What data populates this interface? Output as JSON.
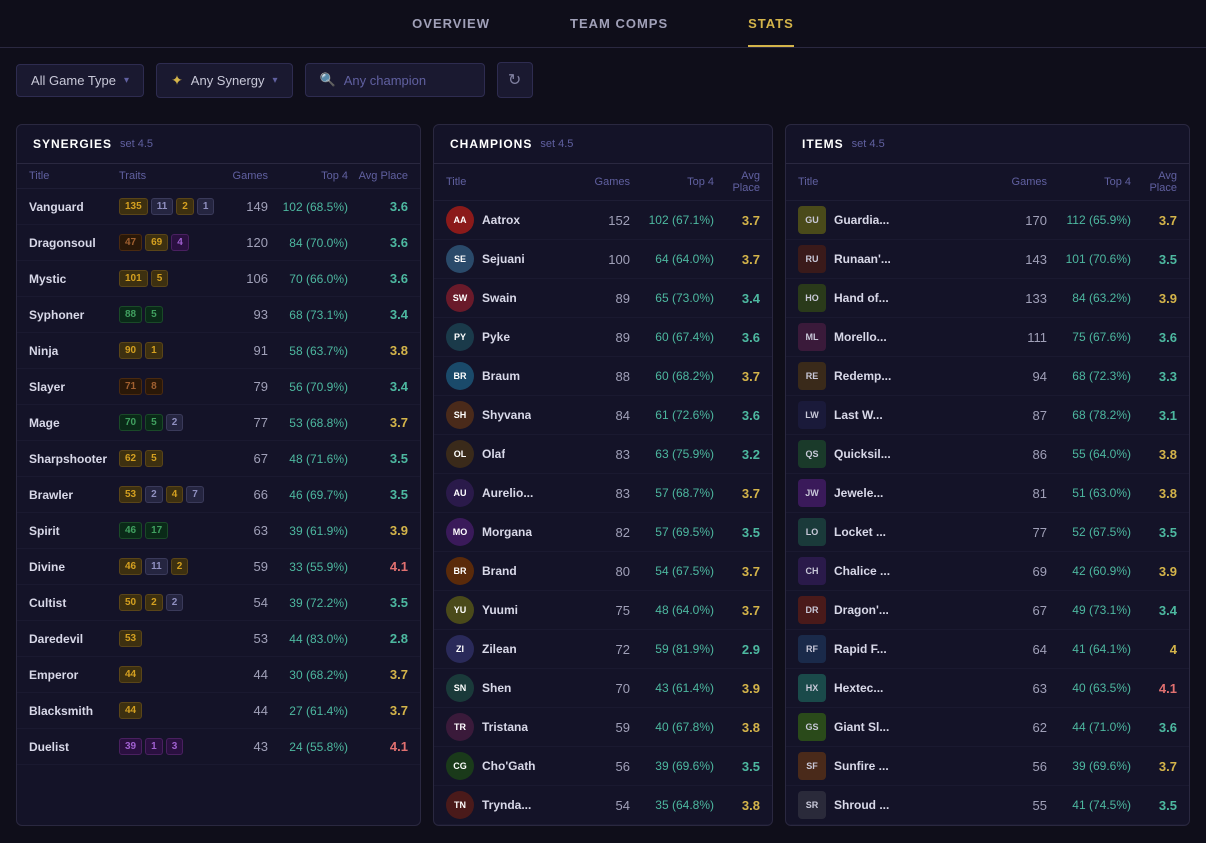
{
  "nav": {
    "items": [
      {
        "id": "overview",
        "label": "OVERVIEW",
        "active": false
      },
      {
        "id": "team-comps",
        "label": "TEAM COMPS",
        "active": false
      },
      {
        "id": "stats",
        "label": "STATS",
        "active": true
      }
    ]
  },
  "filters": {
    "game_type_label": "All Game Type",
    "synergy_label": "Any Synergy",
    "champion_placeholder": "Any champion",
    "refresh_icon": "↻"
  },
  "synergies": {
    "title": "SYNERGIES",
    "set": "set 4.5",
    "columns": [
      "Title",
      "Traits",
      "Games",
      "Top 4",
      "Avg Place"
    ],
    "rows": [
      {
        "name": "Vanguard",
        "badges": [
          {
            "color": "gold",
            "val": "135"
          },
          {
            "color": "silver",
            "val": "11"
          },
          {
            "color": "gold",
            "val": "2"
          },
          {
            "color": "silver",
            "val": "1"
          }
        ],
        "games": 149,
        "top4": "102 (68.5%)",
        "avg": "3.6",
        "avg_class": "avg-good"
      },
      {
        "name": "Dragonsoul",
        "badges": [
          {
            "color": "bronze",
            "val": "47"
          },
          {
            "color": "gold",
            "val": "69"
          },
          {
            "color": "purple",
            "val": "4"
          }
        ],
        "games": 120,
        "top4": "84 (70.0%)",
        "avg": "3.6",
        "avg_class": "avg-good"
      },
      {
        "name": "Mystic",
        "badges": [
          {
            "color": "gold",
            "val": "101"
          },
          {
            "color": "gold",
            "val": "5"
          }
        ],
        "games": 106,
        "top4": "70 (66.0%)",
        "avg": "3.6",
        "avg_class": "avg-good"
      },
      {
        "name": "Syphoner",
        "badges": [
          {
            "color": "green",
            "val": "88"
          },
          {
            "color": "green",
            "val": "5"
          }
        ],
        "games": 93,
        "top4": "68 (73.1%)",
        "avg": "3.4",
        "avg_class": "avg-good"
      },
      {
        "name": "Ninja",
        "badges": [
          {
            "color": "gold",
            "val": "90"
          },
          {
            "color": "gold",
            "val": "1"
          }
        ],
        "games": 91,
        "top4": "58 (63.7%)",
        "avg": "3.8",
        "avg_class": "avg-mid"
      },
      {
        "name": "Slayer",
        "badges": [
          {
            "color": "bronze",
            "val": "71"
          },
          {
            "color": "bronze",
            "val": "8"
          }
        ],
        "games": 79,
        "top4": "56 (70.9%)",
        "avg": "3.4",
        "avg_class": "avg-good"
      },
      {
        "name": "Mage",
        "badges": [
          {
            "color": "green",
            "val": "70"
          },
          {
            "color": "green",
            "val": "5"
          },
          {
            "color": "silver",
            "val": "2"
          }
        ],
        "games": 77,
        "top4": "53 (68.8%)",
        "avg": "3.7",
        "avg_class": "avg-mid"
      },
      {
        "name": "Sharpshooter",
        "badges": [
          {
            "color": "gold",
            "val": "62"
          },
          {
            "color": "gold",
            "val": "5"
          }
        ],
        "games": 67,
        "top4": "48 (71.6%)",
        "avg": "3.5",
        "avg_class": "avg-good"
      },
      {
        "name": "Brawler",
        "badges": [
          {
            "color": "gold",
            "val": "53"
          },
          {
            "color": "silver",
            "val": "2"
          },
          {
            "color": "gold",
            "val": "4"
          },
          {
            "color": "silver",
            "val": "7"
          }
        ],
        "games": 66,
        "top4": "46 (69.7%)",
        "avg": "3.5",
        "avg_class": "avg-good"
      },
      {
        "name": "Spirit",
        "badges": [
          {
            "color": "green",
            "val": "46"
          },
          {
            "color": "green",
            "val": "17"
          }
        ],
        "games": 63,
        "top4": "39 (61.9%)",
        "avg": "3.9",
        "avg_class": "avg-mid"
      },
      {
        "name": "Divine",
        "badges": [
          {
            "color": "gold",
            "val": "46"
          },
          {
            "color": "silver",
            "val": "11"
          },
          {
            "color": "gold",
            "val": "2"
          }
        ],
        "games": 59,
        "top4": "33 (55.9%)",
        "avg": "4.1",
        "avg_class": "avg-bad"
      },
      {
        "name": "Cultist",
        "badges": [
          {
            "color": "gold",
            "val": "50"
          },
          {
            "color": "gold",
            "val": "2"
          },
          {
            "color": "silver",
            "val": "2"
          }
        ],
        "games": 54,
        "top4": "39 (72.2%)",
        "avg": "3.5",
        "avg_class": "avg-good"
      },
      {
        "name": "Daredevil",
        "badges": [
          {
            "color": "gold",
            "val": "53"
          }
        ],
        "games": 53,
        "top4": "44 (83.0%)",
        "avg": "2.8",
        "avg_class": "avg-good"
      },
      {
        "name": "Emperor",
        "badges": [
          {
            "color": "gold",
            "val": "44"
          }
        ],
        "games": 44,
        "top4": "30 (68.2%)",
        "avg": "3.7",
        "avg_class": "avg-mid"
      },
      {
        "name": "Blacksmith",
        "badges": [
          {
            "color": "gold",
            "val": "44"
          }
        ],
        "games": 44,
        "top4": "27 (61.4%)",
        "avg": "3.7",
        "avg_class": "avg-mid"
      },
      {
        "name": "Duelist",
        "badges": [
          {
            "color": "purple",
            "val": "39"
          },
          {
            "color": "purple",
            "val": "1"
          },
          {
            "color": "purple",
            "val": "3"
          }
        ],
        "games": 43,
        "top4": "24 (55.8%)",
        "avg": "4.1",
        "avg_class": "avg-bad"
      }
    ]
  },
  "champions": {
    "title": "CHAMPIONS",
    "set": "set 4.5",
    "columns": [
      "Title",
      "Games",
      "Top 4",
      "Avg Place"
    ],
    "rows": [
      {
        "name": "Aatrox",
        "color": "#8b1a1a",
        "initials": "AA",
        "games": 152,
        "top4": "102 (67.1%)",
        "avg": "3.7",
        "avg_class": "avg-mid"
      },
      {
        "name": "Sejuani",
        "color": "#2a4a6a",
        "initials": "SE",
        "games": 100,
        "top4": "64 (64.0%)",
        "avg": "3.7",
        "avg_class": "avg-mid"
      },
      {
        "name": "Swain",
        "color": "#6a1a2a",
        "initials": "SW",
        "games": 89,
        "top4": "65 (73.0%)",
        "avg": "3.4",
        "avg_class": "avg-good"
      },
      {
        "name": "Pyke",
        "color": "#1a3a4a",
        "initials": "PY",
        "games": 89,
        "top4": "60 (67.4%)",
        "avg": "3.6",
        "avg_class": "avg-good"
      },
      {
        "name": "Braum",
        "color": "#1a4a6a",
        "initials": "BR",
        "games": 88,
        "top4": "60 (68.2%)",
        "avg": "3.7",
        "avg_class": "avg-mid"
      },
      {
        "name": "Shyvana",
        "color": "#4a2a1a",
        "initials": "SH",
        "games": 84,
        "top4": "61 (72.6%)",
        "avg": "3.6",
        "avg_class": "avg-good"
      },
      {
        "name": "Olaf",
        "color": "#3a2a1a",
        "initials": "OL",
        "games": 83,
        "top4": "63 (75.9%)",
        "avg": "3.2",
        "avg_class": "avg-good"
      },
      {
        "name": "Aurelio...",
        "color": "#2a1a4a",
        "initials": "AU",
        "games": 83,
        "top4": "57 (68.7%)",
        "avg": "3.7",
        "avg_class": "avg-mid"
      },
      {
        "name": "Morgana",
        "color": "#3a1a5a",
        "initials": "MO",
        "games": 82,
        "top4": "57 (69.5%)",
        "avg": "3.5",
        "avg_class": "avg-good"
      },
      {
        "name": "Brand",
        "color": "#5a2a0a",
        "initials": "BR",
        "games": 80,
        "top4": "54 (67.5%)",
        "avg": "3.7",
        "avg_class": "avg-mid"
      },
      {
        "name": "Yuumi",
        "color": "#4a4a1a",
        "initials": "YU",
        "games": 75,
        "top4": "48 (64.0%)",
        "avg": "3.7",
        "avg_class": "avg-mid"
      },
      {
        "name": "Zilean",
        "color": "#2a2a5a",
        "initials": "ZI",
        "games": 72,
        "top4": "59 (81.9%)",
        "avg": "2.9",
        "avg_class": "avg-good"
      },
      {
        "name": "Shen",
        "color": "#1a3a3a",
        "initials": "SN",
        "games": 70,
        "top4": "43 (61.4%)",
        "avg": "3.9",
        "avg_class": "avg-mid"
      },
      {
        "name": "Tristana",
        "color": "#3a1a3a",
        "initials": "TR",
        "games": 59,
        "top4": "40 (67.8%)",
        "avg": "3.8",
        "avg_class": "avg-mid"
      },
      {
        "name": "Cho'Gath",
        "color": "#1a3a1a",
        "initials": "CG",
        "games": 56,
        "top4": "39 (69.6%)",
        "avg": "3.5",
        "avg_class": "avg-good"
      },
      {
        "name": "Trynda...",
        "color": "#4a1a1a",
        "initials": "TN",
        "games": 54,
        "top4": "35 (64.8%)",
        "avg": "3.8",
        "avg_class": "avg-mid"
      }
    ]
  },
  "items": {
    "title": "ITEMS",
    "set": "set 4.5",
    "columns": [
      "Title",
      "Games",
      "Top 4",
      "Avg Place"
    ],
    "rows": [
      {
        "name": "Guardia...",
        "color": "#4a4a1a",
        "initials": "GU",
        "games": 170,
        "top4": "112 (65.9%)",
        "avg": "3.7",
        "avg_class": "avg-mid"
      },
      {
        "name": "Runaan'...",
        "color": "#3a1a1a",
        "initials": "RU",
        "games": 143,
        "top4": "101 (70.6%)",
        "avg": "3.5",
        "avg_class": "avg-good"
      },
      {
        "name": "Hand of...",
        "color": "#2a3a1a",
        "initials": "HO",
        "games": 133,
        "top4": "84 (63.2%)",
        "avg": "3.9",
        "avg_class": "avg-mid"
      },
      {
        "name": "Morello...",
        "color": "#3a1a3a",
        "initials": "ML",
        "games": 111,
        "top4": "75 (67.6%)",
        "avg": "3.6",
        "avg_class": "avg-good"
      },
      {
        "name": "Redemp...",
        "color": "#3a2a1a",
        "initials": "RE",
        "games": 94,
        "top4": "68 (72.3%)",
        "avg": "3.3",
        "avg_class": "avg-good"
      },
      {
        "name": "Last W...",
        "color": "#1a1a3a",
        "initials": "LW",
        "games": 87,
        "top4": "68 (78.2%)",
        "avg": "3.1",
        "avg_class": "avg-good"
      },
      {
        "name": "Quicksil...",
        "color": "#1a3a2a",
        "initials": "QS",
        "games": 86,
        "top4": "55 (64.0%)",
        "avg": "3.8",
        "avg_class": "avg-mid"
      },
      {
        "name": "Jewele...",
        "color": "#3a1a5a",
        "initials": "JW",
        "games": 81,
        "top4": "51 (63.0%)",
        "avg": "3.8",
        "avg_class": "avg-mid"
      },
      {
        "name": "Locket ...",
        "color": "#1a3a3a",
        "initials": "LO",
        "games": 77,
        "top4": "52 (67.5%)",
        "avg": "3.5",
        "avg_class": "avg-good"
      },
      {
        "name": "Chalice ...",
        "color": "#2a1a4a",
        "initials": "CH",
        "games": 69,
        "top4": "42 (60.9%)",
        "avg": "3.9",
        "avg_class": "avg-mid"
      },
      {
        "name": "Dragon'...",
        "color": "#4a1a1a",
        "initials": "DR",
        "games": 67,
        "top4": "49 (73.1%)",
        "avg": "3.4",
        "avg_class": "avg-good"
      },
      {
        "name": "Rapid F...",
        "color": "#1a2a4a",
        "initials": "RF",
        "games": 64,
        "top4": "41 (64.1%)",
        "avg": "4",
        "avg_class": "avg-mid"
      },
      {
        "name": "Hextec...",
        "color": "#1a4a4a",
        "initials": "HX",
        "games": 63,
        "top4": "40 (63.5%)",
        "avg": "4.1",
        "avg_class": "avg-bad"
      },
      {
        "name": "Giant Sl...",
        "color": "#2a4a1a",
        "initials": "GS",
        "games": 62,
        "top4": "44 (71.0%)",
        "avg": "3.6",
        "avg_class": "avg-good"
      },
      {
        "name": "Sunfire ...",
        "color": "#4a2a1a",
        "initials": "SF",
        "games": 56,
        "top4": "39 (69.6%)",
        "avg": "3.7",
        "avg_class": "avg-mid"
      },
      {
        "name": "Shroud ...",
        "color": "#2a2a3a",
        "initials": "SR",
        "games": 55,
        "top4": "41 (74.5%)",
        "avg": "3.5",
        "avg_class": "avg-good"
      }
    ]
  }
}
